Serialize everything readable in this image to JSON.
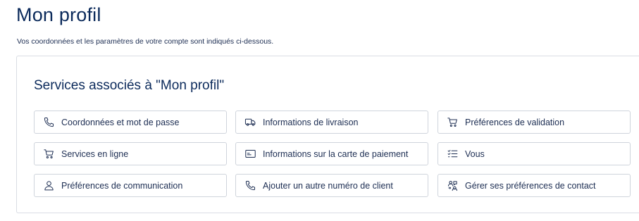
{
  "header": {
    "title": "Mon profil",
    "subtitle": "Vos coordonnées et les paramètres de votre compte sont indiqués ci-dessous."
  },
  "services": {
    "title": "Services associés à \"Mon profil\"",
    "items": [
      {
        "label": "Coordonnées et mot de passe",
        "icon": "phone-icon"
      },
      {
        "label": "Informations de livraison",
        "icon": "truck-icon"
      },
      {
        "label": "Préférences de validation",
        "icon": "cart-icon"
      },
      {
        "label": "Services en ligne",
        "icon": "cart-icon"
      },
      {
        "label": "Informations sur la carte de paiement",
        "icon": "card-icon"
      },
      {
        "label": "Vous",
        "icon": "list-check-icon"
      },
      {
        "label": "Préférences de communication",
        "icon": "user-icon"
      },
      {
        "label": "Ajouter un autre numéro de client",
        "icon": "phone-icon"
      },
      {
        "label": "Gérer ses préférences de contact",
        "icon": "contact-preferences-icon"
      }
    ]
  }
}
